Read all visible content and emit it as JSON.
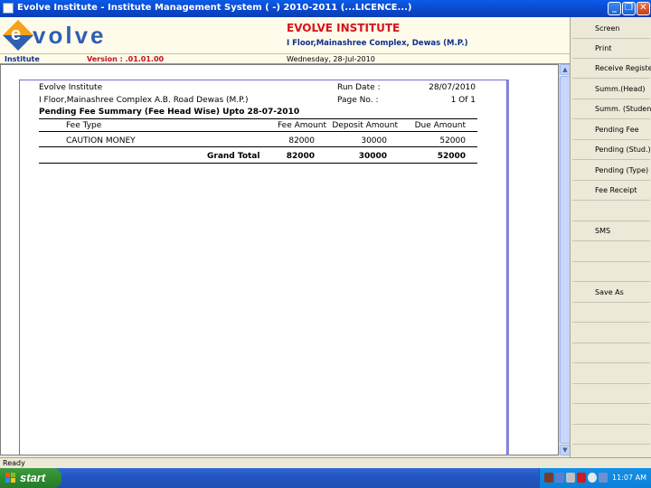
{
  "window": {
    "title": "Evolve Institute - Institute Management System ( -) 2010-2011 (...LICENCE...)",
    "minimize_glyph": "_",
    "restore_glyph": "❐",
    "close_glyph": "✕"
  },
  "header": {
    "logo_text": "volve",
    "logo_letter": "e",
    "institute_name": "EVOLVE INSTITUTE",
    "institute_address": "I Floor,Mainashree Complex, Dewas (M.P.)"
  },
  "infobar": {
    "label": "Institute",
    "version": "Version : .01.01.00",
    "date": "Wednesday, 28-Jul-2010"
  },
  "report": {
    "institute": "Evolve Institute",
    "address": "I Floor,Mainashree Complex A.B. Road Dewas (M.P.)",
    "run_date_label": "Run Date :",
    "run_date_value": "28/07/2010",
    "page_label": "Page No. :",
    "page_value": "1 Of 1",
    "heading": "Pending Fee Summary (Fee Head Wise) Upto 28-07-2010",
    "columns": [
      "Fee Type",
      "Fee Amount",
      "Deposit Amount",
      "Due Amount"
    ],
    "rows": [
      {
        "fee_type": "CAUTION MONEY",
        "fee_amount": "82000",
        "deposit_amount": "30000",
        "due_amount": "52000"
      }
    ],
    "total": {
      "label": "Grand Total",
      "fee_amount": "82000",
      "deposit_amount": "30000",
      "due_amount": "52000"
    }
  },
  "toolbar": {
    "items": [
      "Screen",
      "Print",
      "Receive Register",
      "Summ.(Head)",
      "Summ. (Student)",
      "Pending Fee",
      "Pending (Stud.)",
      "Pending (Type)",
      "Fee Receipt",
      "",
      "SMS",
      "",
      "",
      "Save As"
    ]
  },
  "scrollbar": {
    "up_glyph": "▲",
    "down_glyph": "▼"
  },
  "statusbar": {
    "text": "Ready"
  },
  "taskbar": {
    "start_label": "start",
    "clock": "11:07 AM"
  },
  "colors": {
    "title_blue": "#0b46c8",
    "institute_red": "#d8131b",
    "address_navy": "#0e2e8c",
    "logo_orange": "#f4a21a",
    "logo_blue": "#2f5fb3"
  }
}
